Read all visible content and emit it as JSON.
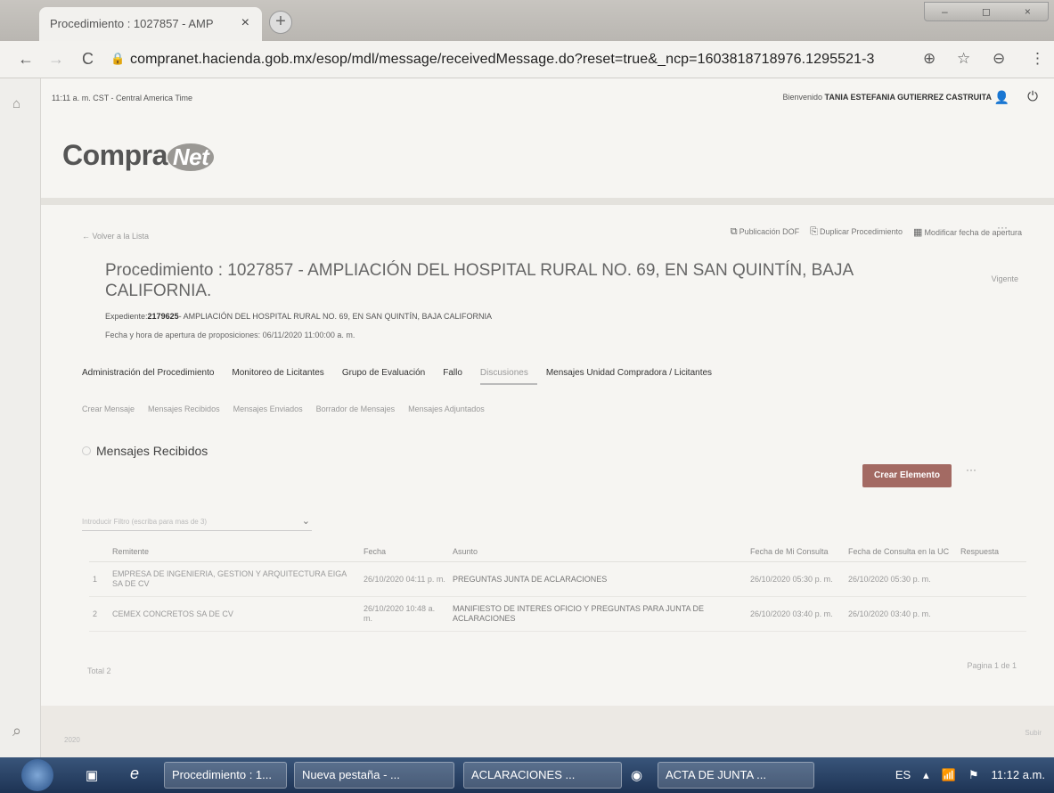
{
  "browser": {
    "tab_title": "Procedimiento : 1027857 - AMP",
    "tab_close": "×",
    "new_tab": "+",
    "window_controls": [
      "–",
      "◻",
      "×"
    ],
    "url": "compranet.hacienda.gob.mx/esop/mdl/message/receivedMessage.do?reset=true&_ncp=1603818718976.1295521-3"
  },
  "header": {
    "time_zone": "11:11 a. m. CST - Central America Time",
    "welcome_prefix": "Bienvenido",
    "user_name": "TANIA ESTEFANIA GUTIERREZ CASTRUITA"
  },
  "logo": {
    "text": "Compra",
    "net": "Net"
  },
  "toolbar": {
    "back_label": "Volver a la Lista",
    "publicacion_dof": "Publicación DOF",
    "duplicar": "Duplicar Procedimiento",
    "modificar_fecha": "Modificar fecha de apertura"
  },
  "procedure": {
    "title": "Procedimiento : 1027857 - AMPLIACIÓN DEL HOSPITAL RURAL NO. 69, EN SAN QUINTÍN, BAJA CALIFORNIA.",
    "status": "Vigente",
    "expediente_label": "Expediente:",
    "expediente_number": "2179625",
    "expediente_desc": "- AMPLIACIÓN DEL HOSPITAL RURAL NO. 69, EN SAN QUINTÍN, BAJA CALIFORNIA",
    "apertura": "Fecha y hora de apertura de proposiciones: 06/11/2020 11:00:00 a. m."
  },
  "main_tabs": [
    "Administración del Procedimiento",
    "Monitoreo de Licitantes",
    "Grupo de Evaluación",
    "Fallo",
    "Discusiones",
    "Mensajes Unidad Compradora / Licitantes"
  ],
  "sub_tabs": [
    "Crear Mensaje",
    "Mensajes Recibidos",
    "Mensajes Enviados",
    "Borrador de Mensajes",
    "Mensajes Adjuntados"
  ],
  "section": {
    "title": "Mensajes Recibidos",
    "create_button": "Crear Elemento",
    "filter_placeholder": "Introducir Filtro (escriba para mas de 3)"
  },
  "table": {
    "headers": [
      "",
      "Remitente",
      "Fecha",
      "Asunto",
      "Fecha de Mi Consulta",
      "Fecha de Consulta en la UC",
      "Respuesta"
    ],
    "rows": [
      {
        "num": "1",
        "remitente": "EMPRESA DE INGENIERIA, GESTION Y ARQUITECTURA EIGA SA DE CV",
        "fecha": "26/10/2020 04:11 p. m.",
        "asunto": "PREGUNTAS JUNTA DE ACLARACIONES",
        "mi_consulta": "26/10/2020 05:30 p. m.",
        "consulta_uc": "26/10/2020 05:30 p. m.",
        "respuesta": ""
      },
      {
        "num": "2",
        "remitente": "CEMEX CONCRETOS SA DE CV",
        "fecha": "26/10/2020 10:48 a. m.",
        "asunto": "MANIFIESTO DE INTERES OFICIO Y PREGUNTAS PARA JUNTA DE ACLARACIONES",
        "mi_consulta": "26/10/2020 03:40 p. m.",
        "consulta_uc": "26/10/2020 03:40 p. m.",
        "respuesta": ""
      }
    ],
    "total": "Total 2",
    "pager": "Pagina 1 de 1"
  },
  "footer": {
    "year": "2020",
    "subir": "Subir"
  },
  "taskbar": {
    "items": [
      "Procedimiento : 1...",
      "Nueva pestaña - ...",
      "ACLARACIONES ...",
      "ACTA DE JUNTA ..."
    ],
    "lang": "ES",
    "clock": "11:12 a.m."
  },
  "colors": {
    "accent_button": "#a36a63",
    "taskbar": "#1d3354"
  },
  "icons": {
    "back": "←",
    "forward": "→",
    "reload": "C",
    "lock": "🔒",
    "zoom": "⊕",
    "star": "☆",
    "account": "⊖",
    "menu": "⋮",
    "user": "👤",
    "power": "⏻",
    "more": "···",
    "chevron": "⌄",
    "search": "⌕",
    "home": "⌂"
  }
}
